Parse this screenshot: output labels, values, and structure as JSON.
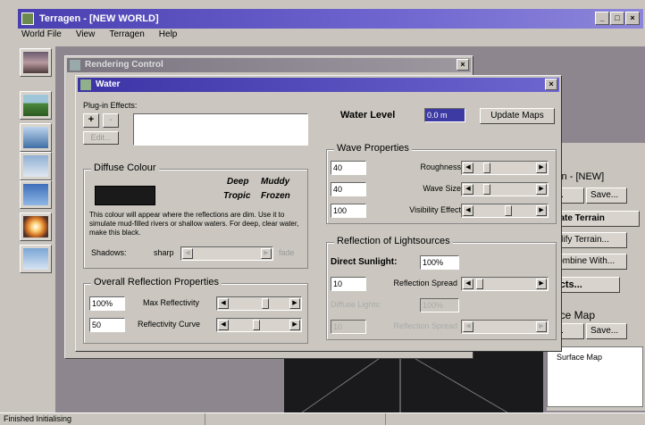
{
  "app": {
    "title": "Terragen - [NEW WORLD]",
    "menu": [
      "World File",
      "View",
      "Terragen",
      "Help"
    ],
    "status": "Finished Initialising"
  },
  "render_dialog": {
    "title": "Rendering Control"
  },
  "terrain_panel": {
    "title": "ain - [NEW]",
    "open_label": "n...",
    "save_label": "Save...",
    "generate_label": "erate Terrain",
    "modify_label": "lodify Terrain...",
    "combine_label": "Combine With...",
    "effects_label": "fects...",
    "surface_title": "ace Map",
    "surface_open": "n...",
    "surface_save": "Save...",
    "surface_item": "Surface Map"
  },
  "water": {
    "title": "Water",
    "plugin_label": "Plug-in Effects:",
    "add_btn": "+",
    "remove_btn": "-",
    "edit_btn": "Edit...",
    "water_level_label": "Water Level",
    "water_level_value": "0.0 m",
    "update_maps_btn": "Update Maps",
    "diffuse": {
      "title": "Diffuse Colour",
      "presets": [
        "Deep",
        "Muddy",
        "Tropic",
        "Frozen"
      ],
      "desc": "This colour will appear where the reflections are dim. Use it to simulate mud-filled rivers or shallow waters. For deep, clear water, make this black.",
      "shadows_label": "Shadows:",
      "shadows_value": "sharp",
      "shadows_end": "fade",
      "colour": "#1a1a1a"
    },
    "reflection": {
      "title": "Overall Reflection Properties",
      "max_value": "100%",
      "max_label": "Max Reflectivity",
      "curve_value": "50",
      "curve_label": "Reflectivity Curve"
    },
    "wave": {
      "title": "Wave Properties",
      "rows": [
        {
          "value": "40",
          "label": "Roughness"
        },
        {
          "value": "40",
          "label": "Wave Size"
        },
        {
          "value": "100",
          "label": "Visibility Effect"
        }
      ]
    },
    "lightsources": {
      "title": "Reflection of Lightsources",
      "direct_label": "Direct Sunlight:",
      "direct_value": "100%",
      "spread_value": "10",
      "spread_label": "Reflection Spread",
      "diffuse_label": "Diffuse Lights:",
      "diffuse_value": "100%",
      "diffuse_spread_value": "10",
      "diffuse_spread_label": "Reflection Spread"
    }
  }
}
